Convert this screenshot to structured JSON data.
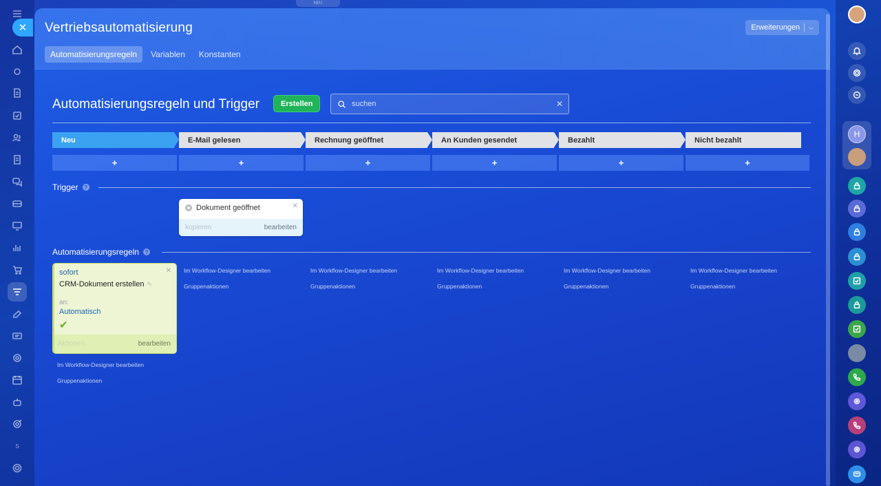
{
  "header": {
    "title": "Vertriebsautomatisierung",
    "extensions_label": "Erweiterungen",
    "top_badge": "NEU"
  },
  "tabs": [
    {
      "label": "Automatisierungsregeln",
      "active": true
    },
    {
      "label": "Variablen",
      "active": false
    },
    {
      "label": "Konstanten",
      "active": false
    }
  ],
  "main": {
    "section_title": "Automatisierungsregeln und Trigger",
    "create_label": "Erstellen",
    "search_placeholder": "suchen"
  },
  "stages": [
    {
      "label": "Neu",
      "color": "#3ba2f2"
    },
    {
      "label": "E-Mail gelesen",
      "color": "#e1e2e5"
    },
    {
      "label": "Rechnung geöffnet",
      "color": "#e1e2e5"
    },
    {
      "label": "An Kunden gesendet",
      "color": "#e1e2e5"
    },
    {
      "label": "Bezahlt",
      "color": "#e1e2e5"
    },
    {
      "label": "Nicht bezahlt",
      "color": "#e1e2e5"
    }
  ],
  "add_label": "+",
  "trigger_section": {
    "heading": "Trigger",
    "card": {
      "title": "Dokument geöffnet",
      "copy_label": "kopieren",
      "edit_label": "bearbeiten"
    }
  },
  "rules_section": {
    "heading": "Automatisierungsregeln",
    "card": {
      "when": "sofort",
      "title": "CRM-Dokument erstellen",
      "for_label": "an:",
      "responsible": "Automatisch",
      "actions_label": "Aktionen",
      "edit_label": "bearbeiten"
    },
    "workflow_link": "Im Workflow-Designer bearbeiten",
    "group_link": "Gruppenaktionen"
  },
  "sidebar_right": {
    "avatar_letter": "H",
    "small_badge": "S"
  },
  "colors": {
    "accent": "#2fa6ff",
    "create_button": "#20b35a",
    "rule_card_bg": "#edf5d4",
    "stage_active": "#3ba2f2"
  }
}
